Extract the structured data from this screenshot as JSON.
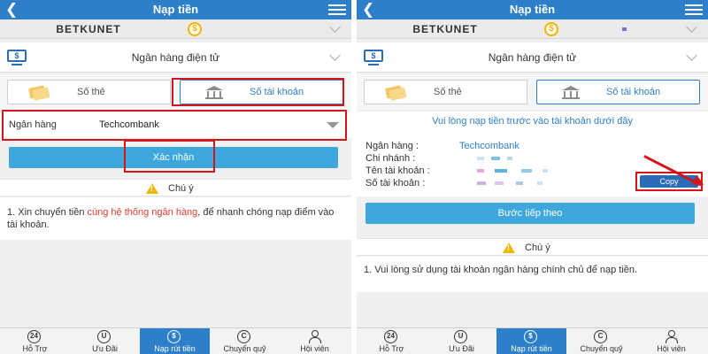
{
  "colors": {
    "header": "#2e7fc9",
    "button": "#3ea7dc",
    "highlight": "#d6151a",
    "link": "#2e7fc9"
  },
  "left": {
    "header": {
      "back_icon": "chevron-left-icon",
      "title": "Nạp tiền",
      "menu_icon": "hamburger-menu-icon"
    },
    "account_name": "BETKUNET",
    "coin_symbol": "$",
    "method": {
      "label": "Ngân hàng điện tử"
    },
    "tabs": [
      {
        "label": "Số thẻ",
        "active": false
      },
      {
        "label": "Số tài khoản",
        "active": true
      }
    ],
    "bank": {
      "label": "Ngân hàng",
      "value": "Techcombank"
    },
    "confirm_button": "Xác nhận",
    "notice_title": "Chú ý",
    "notice": {
      "prefix": "1.   Xin chuyển tiền ",
      "highlight": "cùng hệ thống ngân hàng",
      "suffix": ", để nhanh chóng nạp điểm vào tài khoản."
    }
  },
  "right": {
    "header": {
      "back_icon": "chevron-left-icon",
      "title": "Nạp tiền",
      "menu_icon": "hamburger-menu-icon"
    },
    "account_name": "BETKUNET",
    "coin_symbol": "$",
    "method": {
      "label": "Ngân hàng điện tử"
    },
    "tabs": [
      {
        "label": "Số thẻ",
        "active": false
      },
      {
        "label": "Số tài khoản",
        "active": true
      }
    ],
    "info_prompt": "Vui lòng nạp tiền trước vào tài khoản dưới đây",
    "details": [
      {
        "label": "Ngân hàng :",
        "value": "Techcombank"
      },
      {
        "label": "Chi nhánh :",
        "value": ""
      },
      {
        "label": "Tên tài khoản :",
        "value": ""
      },
      {
        "label": "Số tài khoản :",
        "value": ""
      }
    ],
    "copy_button": "Copy",
    "next_button": "Bước tiếp theo",
    "notice_title": "Chú ý",
    "notice": "1.   Vui lòng sử dụng tài khoản ngân hàng chính chủ để nạp tiền."
  },
  "bottom_nav": [
    {
      "label": "Hỗ Trợ",
      "icon": "support-24-icon",
      "glyph": "24",
      "active": false
    },
    {
      "label": "Ưu Đãi",
      "icon": "promo-u-icon",
      "glyph": "U",
      "active": false
    },
    {
      "label": "Nạp rút tiền",
      "icon": "dollar-circle-icon",
      "glyph": "$",
      "active": true
    },
    {
      "label": "Chuyển quỹ",
      "icon": "transfer-c-icon",
      "glyph": "C",
      "active": false
    },
    {
      "label": "Hội viên",
      "icon": "person-icon",
      "glyph": "",
      "active": false
    }
  ]
}
